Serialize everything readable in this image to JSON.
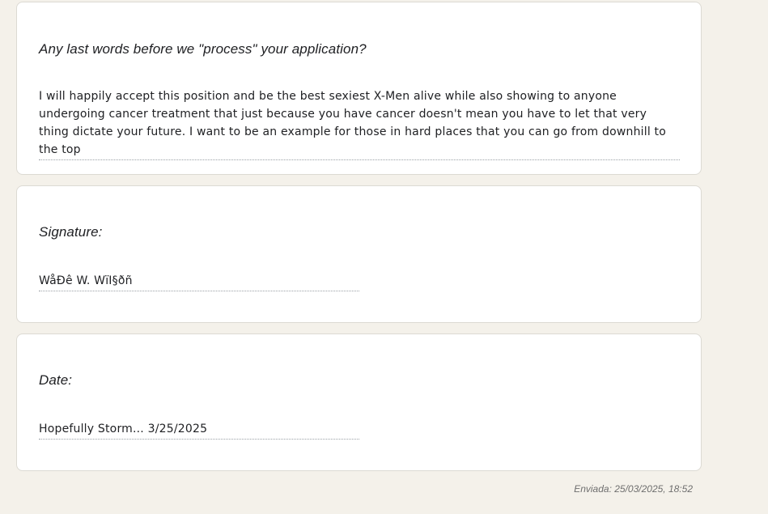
{
  "responses": [
    {
      "question": "Any last words before we \"process\" your application?",
      "answer": "I will happily accept this position and be the best sexiest X-Men alive while also showing to anyone undergoing cancer treatment that just because you have cancer doesn't mean you have to let that very thing dictate your future. I want to be an example for those in hard places that you can go from downhill to the top"
    },
    {
      "question": "Signature:",
      "answer": "WåÐê W. WïI§ðñ"
    },
    {
      "question": "Date:",
      "answer": "Hopefully Storm... 3/25/2025"
    }
  ],
  "footer": {
    "submitted": "Enviada: 25/03/2025, 18:52"
  }
}
